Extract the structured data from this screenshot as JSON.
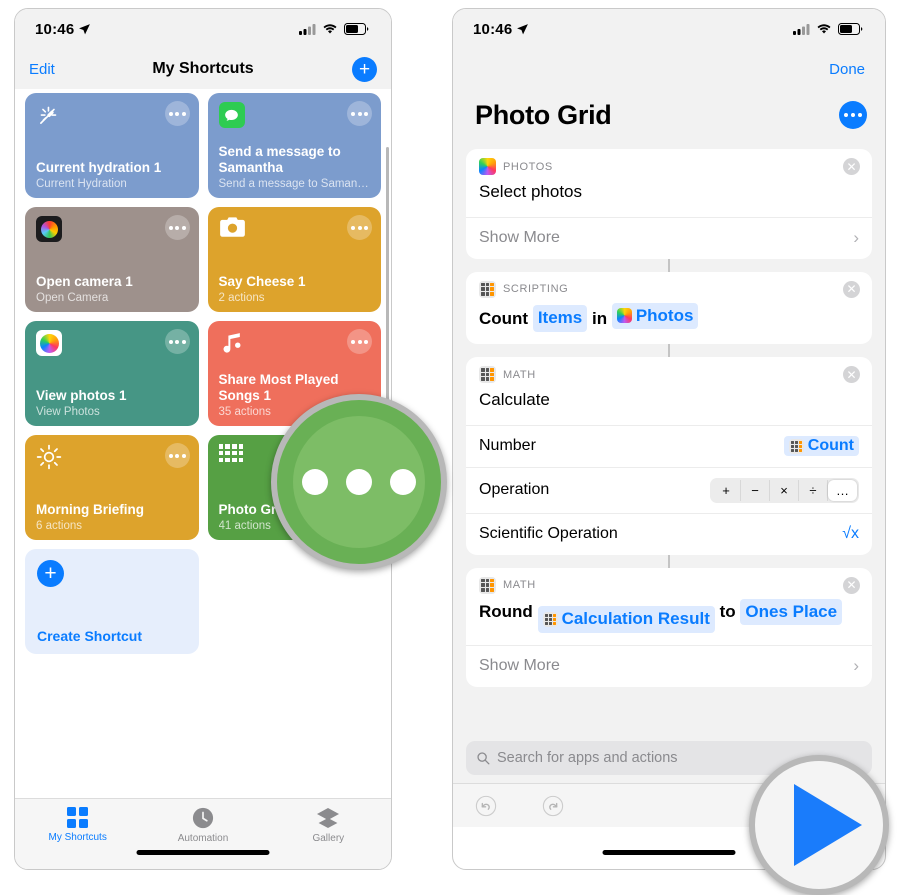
{
  "left_phone": {
    "status_bar": {
      "time": "10:46",
      "location_icon": "location-arrow-icon",
      "cellular_icon": "cellular-bars-icon",
      "wifi_icon": "wifi-icon",
      "battery_icon": "battery-icon"
    },
    "nav": {
      "edit_label": "Edit",
      "title": "My Shortcuts",
      "add_icon": "plus-icon"
    },
    "shortcuts": [
      {
        "title": "Current hydration 1",
        "subtitle": "Current Hydration",
        "color": "#7c9ccd",
        "icon": "magic-wand-icon",
        "more_icon": "ellipsis-icon"
      },
      {
        "title": "Send a message to Samantha",
        "subtitle": "Send a message to Saman…",
        "color": "#7c9ccd",
        "icon": "messages-app-icon",
        "more_icon": "ellipsis-icon"
      },
      {
        "title": "Open camera 1",
        "subtitle": "Open Camera",
        "color": "#9e918c",
        "icon": "camera-app-icon",
        "more_icon": "ellipsis-icon"
      },
      {
        "title": "Say Cheese 1",
        "subtitle": "2 actions",
        "color": "#dda32c",
        "icon": "camera-icon",
        "more_icon": "ellipsis-icon"
      },
      {
        "title": "View photos 1",
        "subtitle": "View Photos",
        "color": "#469685",
        "icon": "photos-app-icon",
        "more_icon": "ellipsis-icon"
      },
      {
        "title": "Share Most Played Songs 1",
        "subtitle": "35 actions",
        "color": "#ef6f5c",
        "icon": "music-note-icon",
        "more_icon": "ellipsis-icon"
      },
      {
        "title": "Morning Briefing",
        "subtitle": "6 actions",
        "color": "#dda32c",
        "icon": "sun-icon",
        "more_icon": "ellipsis-icon"
      },
      {
        "title": "Photo Grid",
        "subtitle": "41 actions",
        "color": "#56a044",
        "icon": "grid-icon",
        "more_icon": "ellipsis-icon"
      }
    ],
    "create_shortcut": {
      "label": "Create Shortcut",
      "icon": "plus-circle-icon"
    },
    "tabs": [
      {
        "label": "My Shortcuts",
        "icon": "squares-grid-icon",
        "active": true
      },
      {
        "label": "Automation",
        "icon": "clock-icon",
        "active": false
      },
      {
        "label": "Gallery",
        "icon": "layers-icon",
        "active": false
      }
    ]
  },
  "right_phone": {
    "status_bar": {
      "time": "10:46",
      "location_icon": "location-arrow-icon",
      "cellular_icon": "cellular-bars-icon",
      "wifi_icon": "wifi-icon",
      "battery_icon": "battery-icon"
    },
    "nav": {
      "done_label": "Done"
    },
    "title": "Photo Grid",
    "more_icon": "ellipsis-circle-icon",
    "cards": [
      {
        "category": "PHOTOS",
        "category_icon": "photos-app-icon",
        "close_icon": "close-circle-icon",
        "main_text": "Select photos",
        "show_more": "Show More",
        "chevron_icon": "chevron-right-icon"
      },
      {
        "category": "SCRIPTING",
        "category_icon": "calculator-icon",
        "close_icon": "close-circle-icon",
        "parts": [
          {
            "text": "Count",
            "type": "plain"
          },
          {
            "text": "Items",
            "type": "token"
          },
          {
            "text": "in",
            "type": "plain"
          },
          {
            "text": "Photos",
            "type": "token",
            "icon": "photos-app-icon"
          }
        ]
      },
      {
        "category": "MATH",
        "category_icon": "calculator-icon",
        "close_icon": "close-circle-icon",
        "main_text": "Calculate",
        "rows": [
          {
            "label": "Number",
            "value": "Count",
            "value_icon": "calculator-icon",
            "type": "token"
          },
          {
            "label": "Operation",
            "type": "segmented",
            "options": [
              "+",
              "−",
              "×",
              "÷",
              "…"
            ],
            "selected": "…"
          },
          {
            "label": "Scientific Operation",
            "value": "√x",
            "type": "link"
          }
        ]
      },
      {
        "category": "MATH",
        "category_icon": "calculator-icon",
        "close_icon": "close-circle-icon",
        "parts": [
          {
            "text": "Round",
            "type": "plain"
          },
          {
            "text": "Calculation Result",
            "type": "token",
            "icon": "calculator-icon"
          },
          {
            "text": "to",
            "type": "plain"
          },
          {
            "text": "Ones Place",
            "type": "token"
          }
        ],
        "show_more": "Show More",
        "chevron_icon": "chevron-right-icon"
      }
    ],
    "search": {
      "placeholder": "Search for apps and actions",
      "icon": "search-icon"
    },
    "toolbar": {
      "undo_icon": "undo-icon",
      "redo_icon": "redo-icon",
      "share_icon": "share-icon"
    }
  },
  "callouts": [
    {
      "name": "ellipsis-magnifier",
      "type": "ellipsis",
      "color": "#69b055"
    },
    {
      "name": "play-magnifier",
      "type": "play",
      "color": "#1a7cfb"
    }
  ]
}
